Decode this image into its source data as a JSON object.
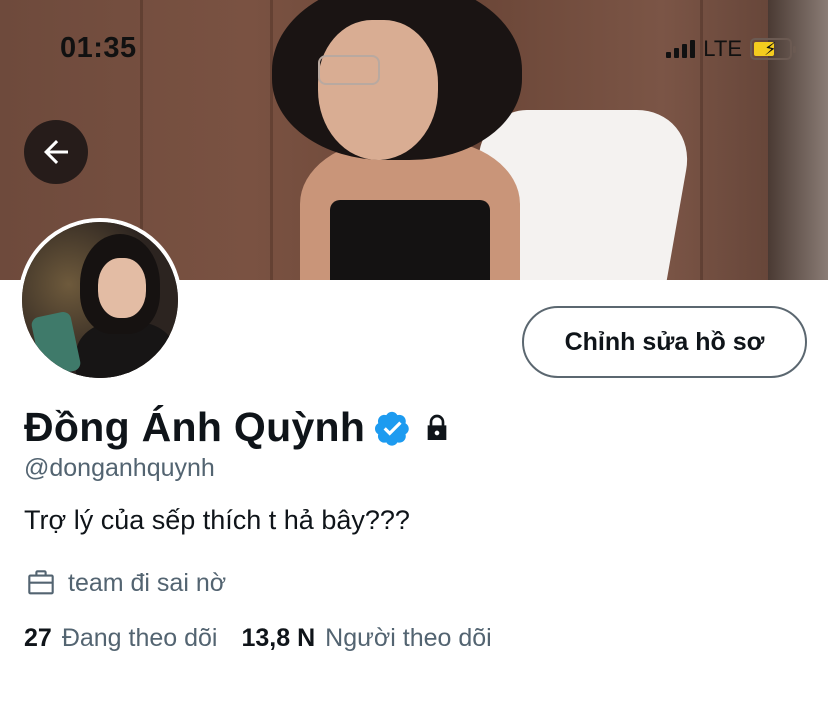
{
  "status_bar": {
    "time": "01:35",
    "network": "LTE"
  },
  "profile": {
    "display_name": "Đồng Ánh Quỳnh",
    "handle": "@donganhquynh",
    "bio": "Trợ lý của sếp thích t hả bây???",
    "work": "team đi sai nờ",
    "verified": true,
    "protected": true,
    "following_count": "27",
    "following_label": "Đang theo dõi",
    "followers_count": "13,8 N",
    "followers_label": "Người theo dõi"
  },
  "actions": {
    "edit_profile_label": "Chỉnh sửa hồ sơ"
  },
  "icons": {
    "back": "arrow-left-icon",
    "verified": "verified-badge-icon",
    "lock": "lock-icon",
    "work": "briefcase-icon"
  },
  "colors": {
    "verified_blue": "#1d9bf0",
    "secondary_text": "#536471",
    "battery_fill": "#f5cc1e"
  }
}
